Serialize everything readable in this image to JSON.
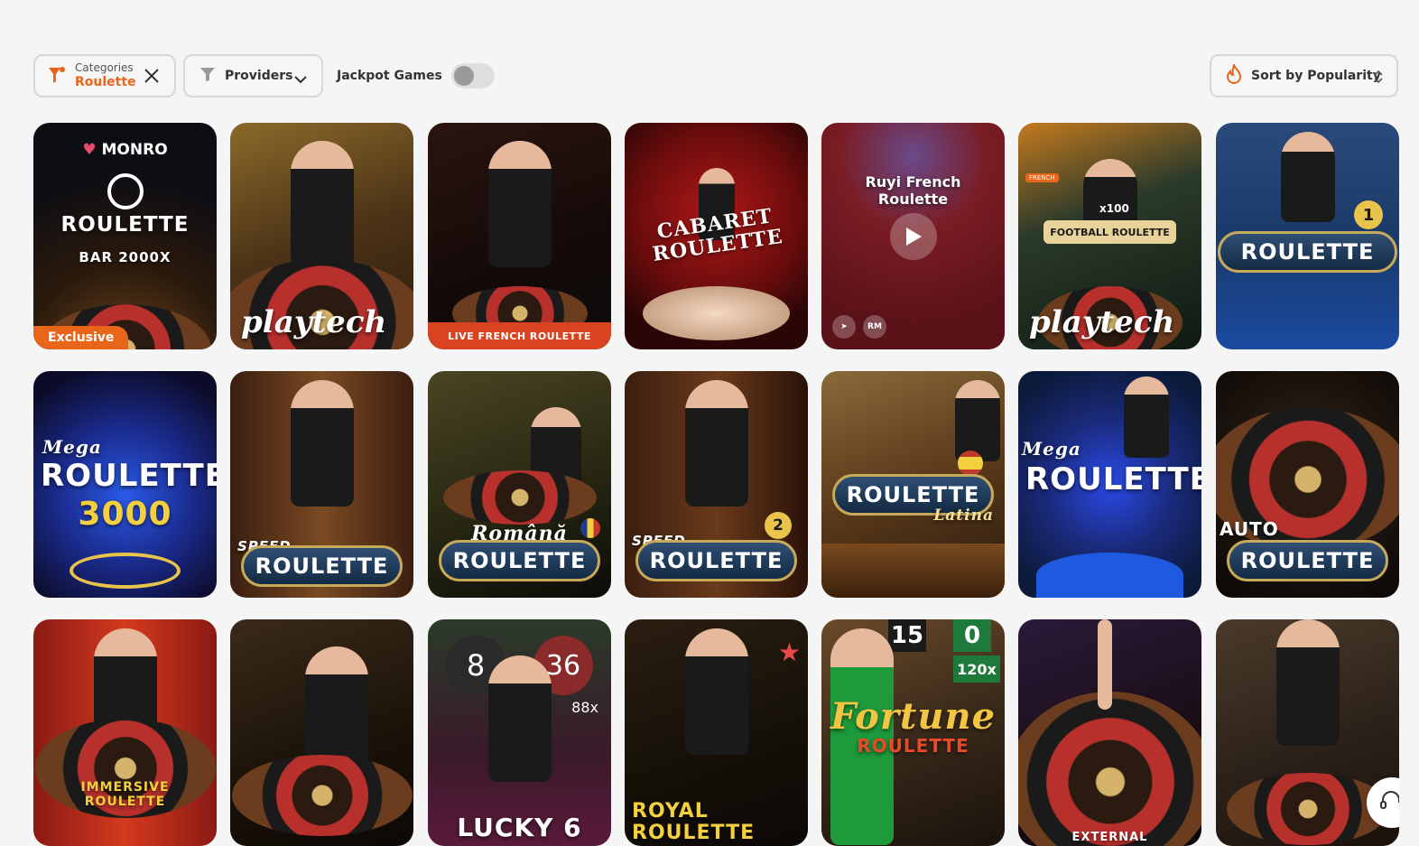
{
  "filters": {
    "categories_label": "Categories",
    "categories_value": "Roulette",
    "providers_label": "Providers",
    "jackpot_label": "Jackpot Games",
    "jackpot_enabled": false,
    "sort_label": "Sort by Popularity"
  },
  "colors": {
    "accent": "#e8651a",
    "page_bg": "#f5f5f5"
  },
  "cards": [
    {
      "name": "monro-roulette",
      "brand": "MONRO",
      "title": "ROULETTE",
      "subtitle": "BAR 2000X",
      "badge": "Exclusive"
    },
    {
      "name": "playtech-roulette",
      "watermark": "playtech"
    },
    {
      "name": "live-french-roulette",
      "strip": "LIVE FRENCH ROULETTE"
    },
    {
      "name": "cabaret-roulette",
      "title": "CABARET ROULETTE"
    },
    {
      "name": "ruyi-french-roulette",
      "title": "Ruyi French Roulette",
      "provider_badge": "RM"
    },
    {
      "name": "football-roulette",
      "title": "FOOTBALL ROULETTE",
      "tag": "FRENCH",
      "multiplier": "x100",
      "watermark": "playtech"
    },
    {
      "name": "roulette-1",
      "title": "ROULETTE",
      "number": "1"
    },
    {
      "name": "mega-roulette-3000",
      "title_top": "Mega",
      "title": "ROULETTE",
      "subtitle": "3000"
    },
    {
      "name": "speed-roulette",
      "title_top": "SPEED",
      "title": "ROULETTE"
    },
    {
      "name": "romana-roulette",
      "title_top": "Română",
      "title": "ROULETTE"
    },
    {
      "name": "speed-roulette-2",
      "title_top": "SPEED",
      "title": "ROULETTE",
      "number": "2"
    },
    {
      "name": "roulette-latina",
      "title": "ROULETTE",
      "subtitle": "Latina"
    },
    {
      "name": "mega-roulette",
      "title_top": "Mega",
      "title": "ROULETTE"
    },
    {
      "name": "auto-roulette",
      "title_top": "AUTO",
      "title": "ROULETTE"
    },
    {
      "name": "immersive-roulette",
      "title": "IMMERSIVE ROULETTE"
    },
    {
      "name": "roulette-live-dealer"
    },
    {
      "name": "lucky-6",
      "title": "LUCKY 6",
      "numbers": [
        "8",
        "36",
        "88x"
      ]
    },
    {
      "name": "royal-roulette",
      "title": "ROYAL ROULETTE"
    },
    {
      "name": "fortune-roulette",
      "title": "Fortune",
      "subtitle": "ROULETTE",
      "numbers": [
        "15",
        "0",
        "120x"
      ]
    },
    {
      "name": "external-roulette",
      "title": "EXTERNAL"
    },
    {
      "name": "roulette-live-dealer-2"
    }
  ]
}
